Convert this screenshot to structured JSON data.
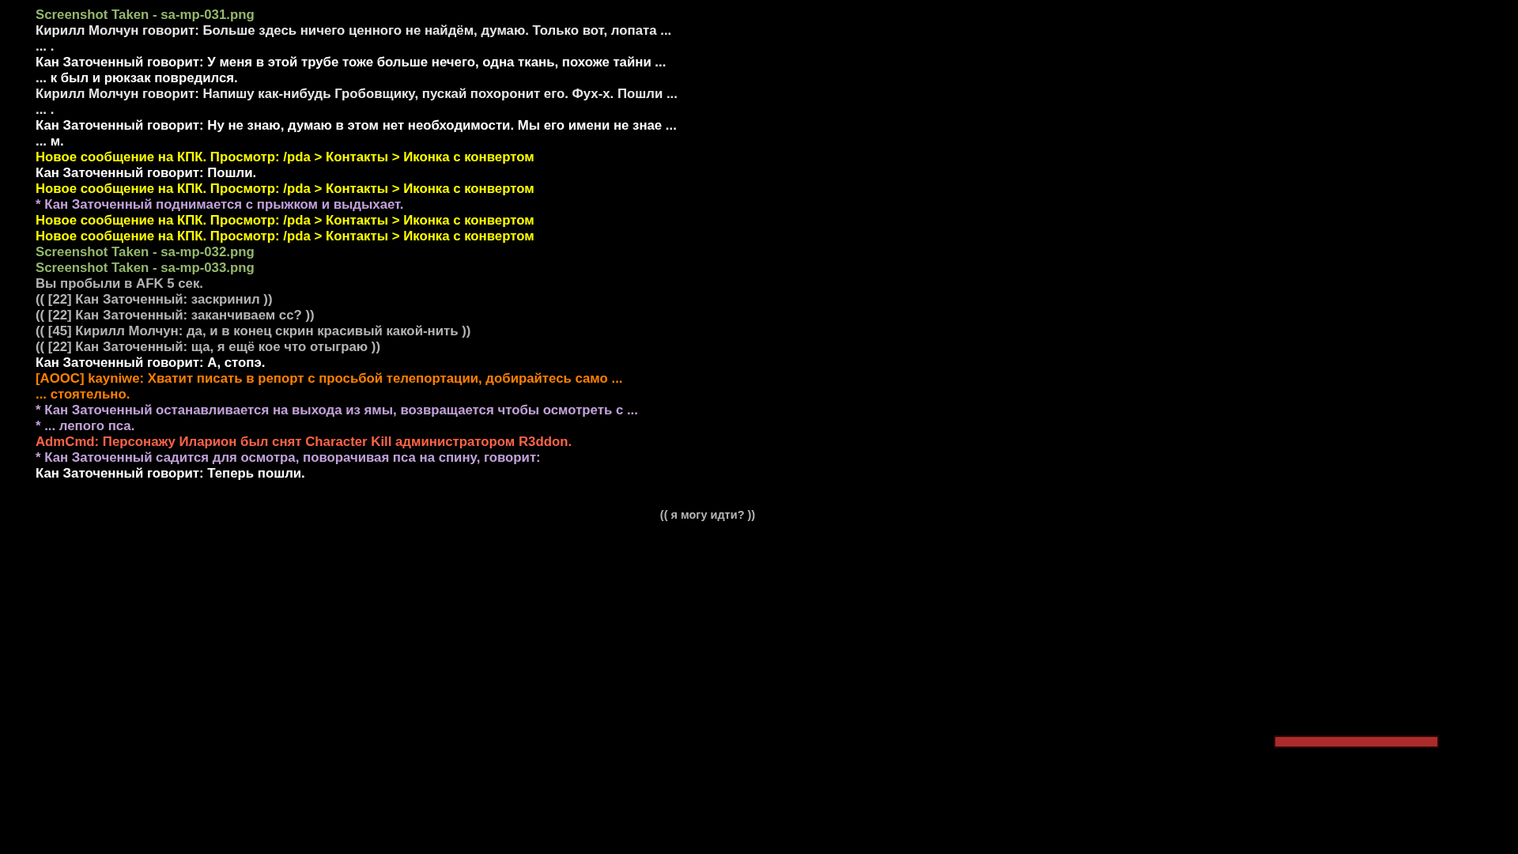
{
  "chat_lines": [
    {
      "text": "Screenshot Taken - sa-mp-031.png",
      "color": "#94b86c"
    },
    {
      "text": "Кирилл Молчун говорит: Больше здесь ничего ценного не найдём, думаю. Только вот, лопата ...",
      "color": "#e6e6e6"
    },
    {
      "text": "... .",
      "color": "#e6e6e6"
    },
    {
      "text": "Кан Заточенный говорит: У меня в этой трубе тоже больше нечего, одна ткань, похоже тайни ...",
      "color": "#ffffff"
    },
    {
      "text": "... к был и рюкзак повредился.",
      "color": "#ffffff"
    },
    {
      "text": "Кирилл Молчун говорит: Напишу как-нибудь Гробовщику, пускай похоронит его. Фух-х. Пошли ...",
      "color": "#e6e6e6"
    },
    {
      "text": "... .",
      "color": "#e6e6e6"
    },
    {
      "text": "Кан Заточенный говорит: Ну не знаю, думаю в этом нет необходимости. Мы его имени не знае ...",
      "color": "#ffffff"
    },
    {
      "text": "... м.",
      "color": "#ffffff"
    },
    {
      "text": "Новое сообщение на КПК. Просмотр: /pda > Контакты > Иконка с конвертом",
      "color": "#ffff00"
    },
    {
      "text": "Кан Заточенный говорит: Пошли.",
      "color": "#ffffff"
    },
    {
      "text": "Новое сообщение на КПК. Просмотр: /pda > Контакты > Иконка с конвертом",
      "color": "#ffff00"
    },
    {
      "text": "* Кан Заточенный поднимается с прыжком и выдыхает.",
      "color": "#c2a2da"
    },
    {
      "text": "Новое сообщение на КПК. Просмотр: /pda > Контакты > Иконка с конвертом",
      "color": "#ffff00"
    },
    {
      "text": "Новое сообщение на КПК. Просмотр: /pda > Контакты > Иконка с конвертом",
      "color": "#ffff00"
    },
    {
      "text": "Screenshot Taken - sa-mp-032.png",
      "color": "#94b86c"
    },
    {
      "text": "Screenshot Taken - sa-mp-033.png",
      "color": "#94b86c"
    },
    {
      "text": "Вы пробыли в AFK 5 сек.",
      "color": "#b4b4b4"
    },
    {
      "text": "(( [22] Кан Заточенный: заскринил ))",
      "color": "#b4b4b4"
    },
    {
      "text": "(( [22] Кан Заточенный: заканчиваем сс? ))",
      "color": "#b4b4b4"
    },
    {
      "text": "(( [45] Кирилл Молчун: да, и в конец скрин красивый какой-нить ))",
      "color": "#b4b4b4"
    },
    {
      "text": "(( [22] Кан Заточенный: ща, я ещё кое что отыграю ))",
      "color": "#b4b4b4"
    },
    {
      "text": "Кан Заточенный говорит: А, стопэ.",
      "color": "#ffffff"
    },
    {
      "text": "[AOOC] kayniwe: Хватит писать в репорт с просьбой телепортации, добирайтесь само ...",
      "color": "#ff8000"
    },
    {
      "text": "... стоятельно.",
      "color": "#ff8000"
    },
    {
      "text": "* Кан Заточенный останавливается на выхода из ямы, возвращается чтобы осмотреть с ...",
      "color": "#c2a2da"
    },
    {
      "text": "* ... лепого пса.",
      "color": "#c2a2da"
    },
    {
      "text": "AdmCmd: Персонажу Иларион был снят Character Kill администратором R3ddon.",
      "color": "#ff6347"
    },
    {
      "text": "* Кан Заточенный садится для осмотра, поворачивая пса на спину, говорит:",
      "color": "#c2a2da"
    },
    {
      "text": "Кан Заточенный говорит: Теперь пошли.",
      "color": "#ffffff"
    }
  ],
  "center_text": "(( я могу идти? ))",
  "health_bar": {
    "level": 1
  }
}
